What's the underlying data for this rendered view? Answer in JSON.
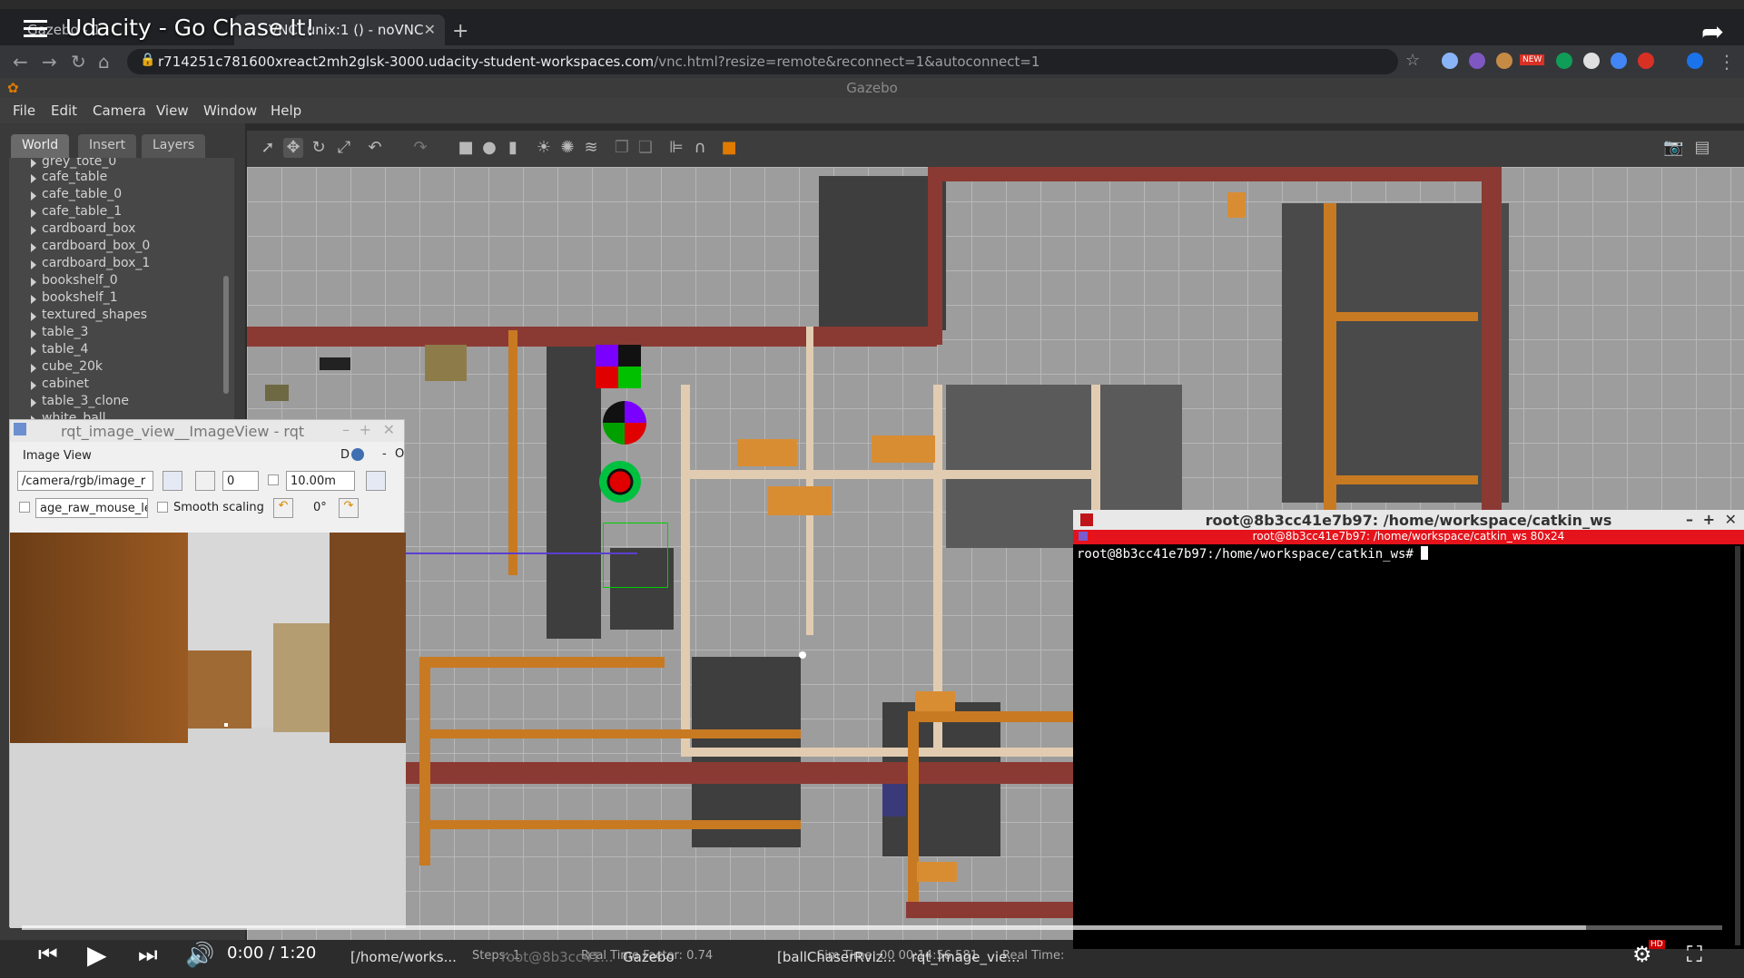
{
  "video": {
    "title": "Udacity - Go Chase It!",
    "time": "0:00 / 1:20",
    "progress_fraction": 0.0,
    "buffered_fraction": 0.92
  },
  "browser": {
    "tabs": [
      {
        "label": "Gazebo - 1"
      },
      {
        "label": "VNC: unix:1 () - noVNC"
      }
    ],
    "url_host": "r714251c781600xreact2mh2glsk-3000.udacity-student-workspaces.com",
    "url_path": "/vnc.html?resize=remote&reconnect=1&autoconnect=1",
    "ext_badge": "NEW"
  },
  "gazebo": {
    "title": "Gazebo",
    "menu": [
      "File",
      "Edit",
      "Camera",
      "View",
      "Window",
      "Help"
    ],
    "tabs": [
      "World",
      "Insert",
      "Layers"
    ],
    "tree": [
      "grey_tote_0",
      "cafe_table",
      "cafe_table_0",
      "cafe_table_1",
      "cardboard_box",
      "cardboard_box_0",
      "cardboard_box_1",
      "bookshelf_0",
      "bookshelf_1",
      "textured_shapes",
      "table_3",
      "table_4",
      "cube_20k",
      "cabinet",
      "table_3_clone",
      "white_ball"
    ],
    "status": {
      "steps": "Steps: 1",
      "rtf": "Real Time Factor: 0.74",
      "sim": "Sim Time: 00 00:14:56.581",
      "real": "Real Time:"
    }
  },
  "rqt": {
    "title": "rqt_image_view__ImageView - rqt",
    "subtitle": "Image View",
    "help": "D",
    "topic": "/camera/rgb/image_r",
    "rotation_value": "0",
    "zoom_value": "10.00m",
    "mouse_topic": "age_raw_mouse_left",
    "smooth_label": "Smooth scaling",
    "angle": "0°"
  },
  "terminal": {
    "title": "root@8b3cc41e7b97: /home/workspace/catkin_ws",
    "subtitle": "root@8b3cc41e7b97: /home/workspace/catkin_ws 80x24",
    "prompt": "root@8b3cc41e7b97:/home/workspace/catkin_ws# "
  },
  "taskbar": {
    "items": [
      "[/home/works...",
      "root@8b3cc41...",
      "Gazebo",
      "[ballChaserRviz...",
      "rqt_image_vie..."
    ],
    "hd_badge": "HD"
  }
}
